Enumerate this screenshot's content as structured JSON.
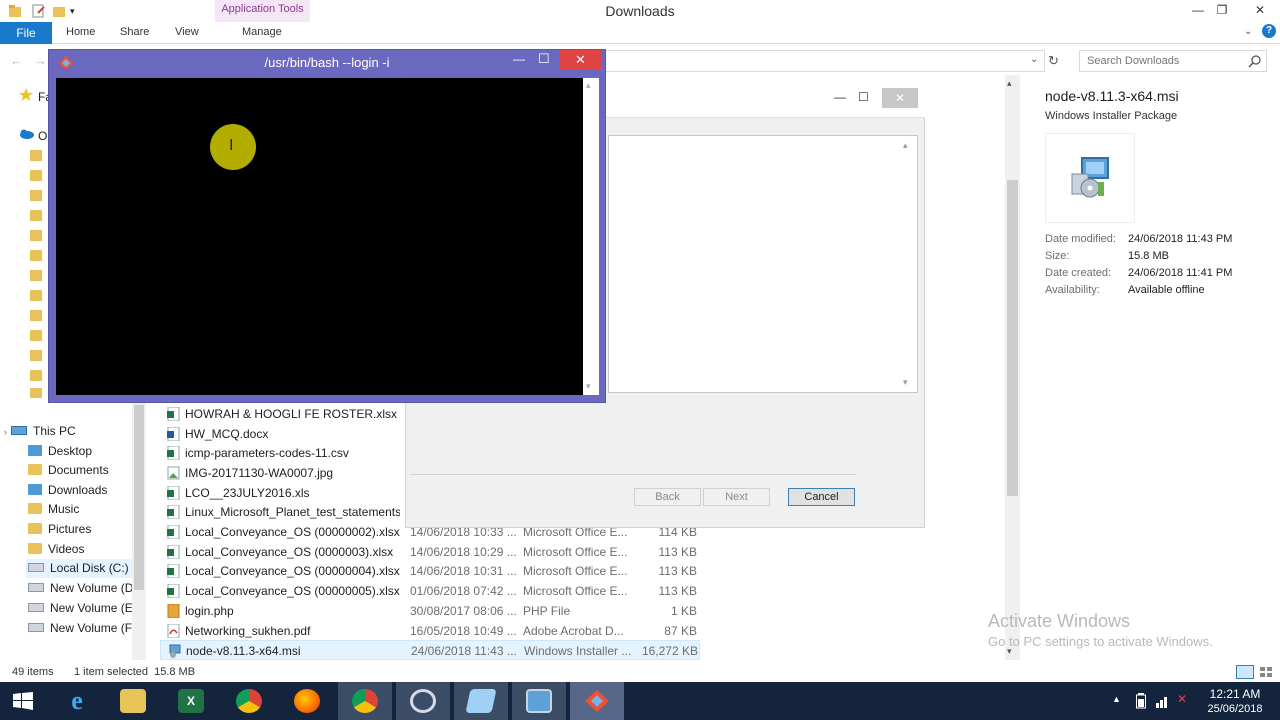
{
  "window": {
    "title": "Downloads"
  },
  "ribbon": {
    "context_tab": "Application Tools",
    "tabs": [
      "File",
      "Home",
      "Share",
      "View",
      "Manage"
    ]
  },
  "search": {
    "placeholder": "Search Downloads"
  },
  "nav": {
    "top_partial": [
      "Fa",
      "O"
    ],
    "this_pc": "This PC",
    "items": [
      "Desktop",
      "Documents",
      "Downloads",
      "Music",
      "Pictures",
      "Videos",
      "Local Disk (C:)",
      "New Volume (D:)",
      "New Volume (E:)",
      "New Volume (F:)"
    ]
  },
  "files": [
    {
      "name": "HOWRAH & HOOGLI FE ROSTER.xlsx",
      "date": "",
      "type": "",
      "size": "",
      "icon": "excel-icon"
    },
    {
      "name": "HW_MCQ.docx",
      "date": "",
      "type": "",
      "size": "",
      "icon": "word-icon"
    },
    {
      "name": "icmp-parameters-codes-11.csv",
      "date": "",
      "type": "",
      "size": "",
      "icon": "excel-icon"
    },
    {
      "name": "IMG-20171130-WA0007.jpg",
      "date": "",
      "type": "",
      "size": "",
      "icon": "image-icon"
    },
    {
      "name": "LCO__23JULY2016.xls",
      "date": "",
      "type": "",
      "size": "",
      "icon": "excel-icon"
    },
    {
      "name": "Linux_Microsoft_Planet_test_statements_...",
      "date": "",
      "type": "",
      "size": "",
      "icon": "excel-icon"
    },
    {
      "name": "Local_Conveyance_OS (00000002).xlsx",
      "date": "14/06/2018 10:33 ...",
      "type": "Microsoft Office E...",
      "size": "114 KB",
      "icon": "excel-icon"
    },
    {
      "name": "Local_Conveyance_OS (0000003).xlsx",
      "date": "14/06/2018 10:29 ...",
      "type": "Microsoft Office E...",
      "size": "113 KB",
      "icon": "excel-icon"
    },
    {
      "name": "Local_Conveyance_OS (00000004).xlsx",
      "date": "14/06/2018 10:31 ...",
      "type": "Microsoft Office E...",
      "size": "113 KB",
      "icon": "excel-icon"
    },
    {
      "name": "Local_Conveyance_OS (00000005).xlsx",
      "date": "01/06/2018 07:42 ...",
      "type": "Microsoft Office E...",
      "size": "113 KB",
      "icon": "excel-icon"
    },
    {
      "name": "login.php",
      "date": "30/08/2017 08:06 ...",
      "type": "PHP File",
      "size": "1 KB",
      "icon": "php-icon"
    },
    {
      "name": "Networking_sukhen.pdf",
      "date": "16/05/2018 10:49 ...",
      "type": "Adobe Acrobat D...",
      "size": "87 KB",
      "icon": "pdf-icon"
    },
    {
      "name": "node-v8.11.3-x64.msi",
      "date": "24/06/2018 11:43 ...",
      "type": "Windows Installer ...",
      "size": "16,272 KB",
      "icon": "installer-icon"
    }
  ],
  "details": {
    "filename": "node-v8.11.3-x64.msi",
    "filetype": "Windows Installer Package",
    "rows": [
      {
        "label": "Date modified:",
        "value": "24/06/2018 11:43 PM"
      },
      {
        "label": "Size:",
        "value": "15.8 MB"
      },
      {
        "label": "Date created:",
        "value": "24/06/2018 11:41 PM"
      },
      {
        "label": "Availability:",
        "value": "Available offline"
      }
    ]
  },
  "status": {
    "items": "49 items",
    "selected": "1 item selected  15.8 MB"
  },
  "installer": {
    "back": "Back",
    "next": "Next",
    "cancel": "Cancel"
  },
  "bash": {
    "title": "/usr/bin/bash --login -i"
  },
  "watermark": {
    "title": "Activate Windows",
    "subtitle": "Go to PC settings to activate Windows."
  },
  "taskbar": {
    "time": "12:21 AM",
    "date": "25/06/2018"
  },
  "colors": {
    "file_tab": "#1979ca",
    "bash_frame": "#6b68c0",
    "taskbar": "#14243d",
    "close_red": "#e04343"
  }
}
